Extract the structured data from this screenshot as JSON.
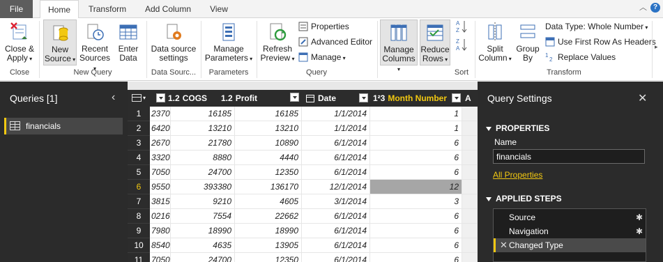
{
  "tabs": [
    "File",
    "Home",
    "Transform",
    "Add Column",
    "View"
  ],
  "ribbon": {
    "close_apply": "Close &",
    "close_apply2": "Apply",
    "new_source": "New",
    "new_source2": "Source",
    "recent_sources": "Recent",
    "recent_sources2": "Sources",
    "enter_data": "Enter",
    "enter_data2": "Data",
    "data_source_settings": "Data source",
    "data_source_settings2": "settings",
    "manage_parameters": "Manage",
    "manage_parameters2": "Parameters",
    "refresh_preview": "Refresh",
    "refresh_preview2": "Preview",
    "properties": "Properties",
    "advanced_editor": "Advanced Editor",
    "manage": "Manage",
    "manage_columns": "Manage",
    "manage_columns2": "Columns",
    "reduce_rows": "Reduce",
    "reduce_rows2": "Rows",
    "split_column": "Split",
    "split_column2": "Column",
    "group_by": "Group",
    "group_by2": "By",
    "data_type": "Data Type: Whole Number",
    "use_first_row": "Use First Row As Headers",
    "replace_values": "Replace Values",
    "groups": {
      "close": "Close",
      "new_query": "New Query",
      "data_sources": "Data Sourc...",
      "parameters": "Parameters",
      "query": "Query",
      "sort": "Sort",
      "transform": "Transform"
    }
  },
  "queries_pane": {
    "title": "Queries [1]",
    "items": [
      "financials"
    ]
  },
  "grid": {
    "columns": [
      {
        "type": "1.2",
        "name": "COGS"
      },
      {
        "type": "1.2",
        "name": "Profit"
      },
      {
        "type": "",
        "name": "Date"
      },
      {
        "type": "1²3",
        "name": "Month Number"
      },
      {
        "type": "A",
        "name": ""
      }
    ],
    "rows": [
      {
        "n": "1",
        "c0": "2370",
        "c1": "16185",
        "c2": "16185",
        "c3": "1/1/2014",
        "c4": "1"
      },
      {
        "n": "2",
        "c0": "6420",
        "c1": "13210",
        "c2": "13210",
        "c3": "1/1/2014",
        "c4": "1"
      },
      {
        "n": "3",
        "c0": "2670",
        "c1": "21780",
        "c2": "10890",
        "c3": "6/1/2014",
        "c4": "6"
      },
      {
        "n": "4",
        "c0": "3320",
        "c1": "8880",
        "c2": "4440",
        "c3": "6/1/2014",
        "c4": "6"
      },
      {
        "n": "5",
        "c0": "7050",
        "c1": "24700",
        "c2": "12350",
        "c3": "6/1/2014",
        "c4": "6"
      },
      {
        "n": "6",
        "c0": "9550",
        "c1": "393380",
        "c2": "136170",
        "c3": "12/1/2014",
        "c4": "12"
      },
      {
        "n": "7",
        "c0": "3815",
        "c1": "9210",
        "c2": "4605",
        "c3": "3/1/2014",
        "c4": "3"
      },
      {
        "n": "8",
        "c0": "0216",
        "c1": "7554",
        "c2": "22662",
        "c3": "6/1/2014",
        "c4": "6"
      },
      {
        "n": "9",
        "c0": "7980",
        "c1": "18990",
        "c2": "18990",
        "c3": "6/1/2014",
        "c4": "6"
      },
      {
        "n": "10",
        "c0": "8540",
        "c1": "4635",
        "c2": "13905",
        "c3": "6/1/2014",
        "c4": "6"
      },
      {
        "n": "11",
        "c0": "7050",
        "c1": "24700",
        "c2": "12350",
        "c3": "6/1/2014",
        "c4": "6"
      }
    ]
  },
  "settings": {
    "title": "Query Settings",
    "properties_header": "PROPERTIES",
    "name_label": "Name",
    "name_value": "financials",
    "all_properties": "All Properties",
    "applied_steps_header": "APPLIED STEPS",
    "steps": [
      "Source",
      "Navigation",
      "Changed Type"
    ]
  },
  "colors": {
    "accent": "#f2c811",
    "dark_pane": "#2b2b2b",
    "grid_header": "#2c2c2c"
  }
}
